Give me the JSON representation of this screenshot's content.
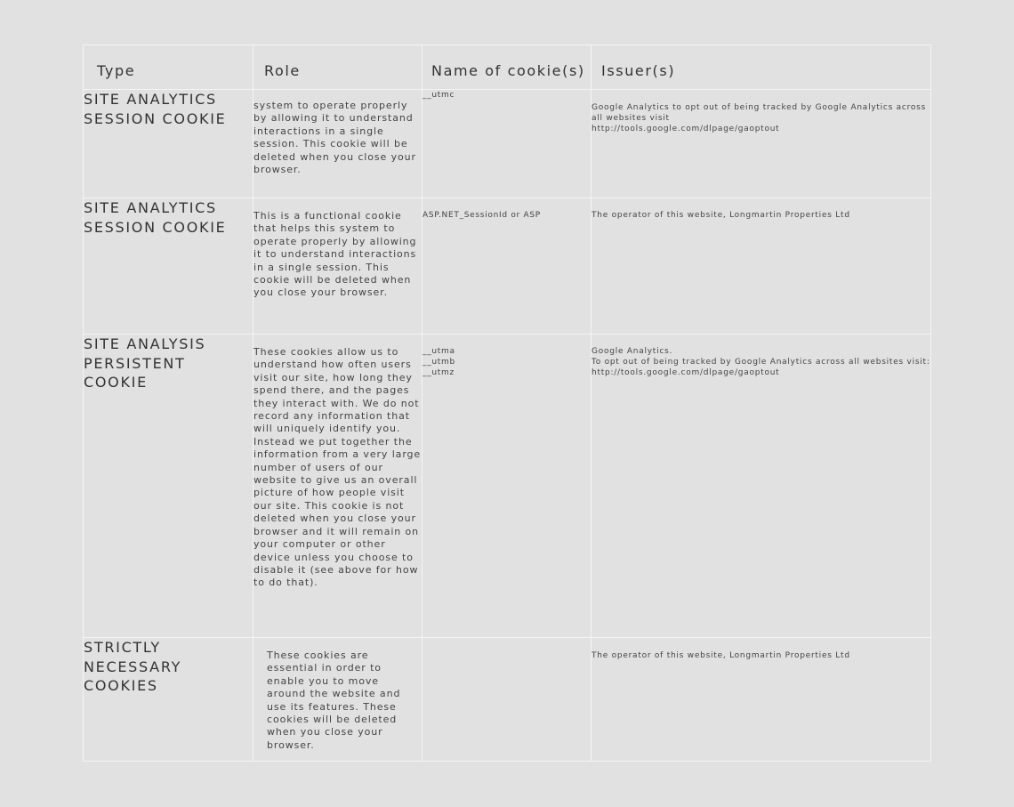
{
  "table": {
    "headers": {
      "type": "Type",
      "role": "Role",
      "name": "Name of cookie(s)",
      "issuer": "Issuer(s)"
    },
    "rows": [
      {
        "type": "SITE ANALYTICS SESSION COOKIE",
        "role": "system to operate properly by allowing it to understand interactions in a single session. This cookie will be deleted when you close your browser.",
        "name": "__utmc",
        "issuer": "Google Analytics to opt out of being tracked by Google Analytics across all websites visit\nhttp://tools.google.com/dlpage/gaoptout"
      },
      {
        "type": "SITE ANALYTICS SESSION COOKIE",
        "role": "This is a functional cookie that helps this system to operate properly by allowing it to understand interactions in a single session.  This cookie will be deleted when you close your browser.",
        "name": "ASP.NET_SessionId or ASP",
        "issuer": "The operator of this website, Longmartin Properties Ltd"
      },
      {
        "type": "SITE ANALYSIS PERSISTENT COOKIE",
        "role": "These cookies allow us to understand how often users visit our site, how long they spend there, and the pages they interact with. We do not record any information that will uniquely identify you. Instead we put together the information from a very large number of users of our website to give us an overall picture of how people visit our site. This cookie is not deleted when you close your browser and it will remain on your computer or other device unless you choose to disable it (see above for how to do that).",
        "name": "__utma\n__utmb\n__utmz",
        "issuer": "Google Analytics.\nTo opt out of being tracked by Google Analytics across all websites visit:\nhttp://tools.google.com/dlpage/gaoptout"
      },
      {
        "type": "STRICTLY NECESSARY COOKIES",
        "role": "These cookies are essential in order to enable you to move around the website and use its features.  These cookies will be deleted when you close your browser.",
        "name": "",
        "issuer": "The operator of this website, Longmartin Properties Ltd"
      }
    ]
  },
  "colors": {
    "background": "#e1e1e1",
    "border": "#f4f4f4",
    "text": "#3c3c3c"
  }
}
